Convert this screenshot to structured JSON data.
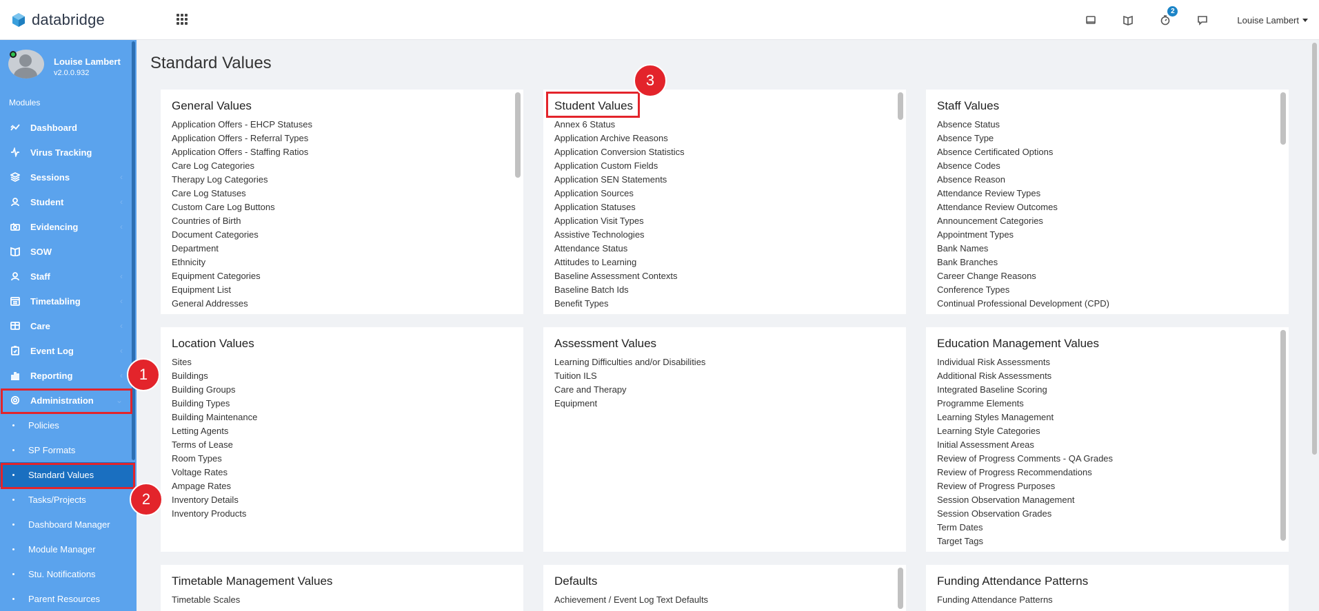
{
  "app": {
    "name": "databridge"
  },
  "topbar": {
    "notification_count": "2",
    "user_name": "Louise Lambert",
    "icons": [
      "tablet-icon",
      "book-icon",
      "timer-icon",
      "chat-icon"
    ]
  },
  "profile": {
    "name": "Louise Lambert",
    "version": "v2.0.0.932"
  },
  "sidebar": {
    "modules_label": "Modules",
    "items": [
      {
        "label": "Dashboard",
        "icon": "trend-icon"
      },
      {
        "label": "Virus Tracking",
        "icon": "pulse-icon"
      },
      {
        "label": "Sessions",
        "icon": "layers-icon"
      },
      {
        "label": "Student",
        "icon": "student-icon"
      },
      {
        "label": "Evidencing",
        "icon": "camera-icon"
      },
      {
        "label": "SOW",
        "icon": "book-icon"
      },
      {
        "label": "Staff",
        "icon": "staff-icon"
      },
      {
        "label": "Timetabling",
        "icon": "calendar-icon"
      },
      {
        "label": "Care",
        "icon": "care-icon"
      },
      {
        "label": "Event Log",
        "icon": "clipboard-icon"
      },
      {
        "label": "Reporting",
        "icon": "bar-chart-icon"
      },
      {
        "label": "Administration",
        "icon": "gear-icon"
      }
    ],
    "subitems": [
      {
        "label": "Policies"
      },
      {
        "label": "SP Formats"
      },
      {
        "label": "Standard Values"
      },
      {
        "label": "Tasks/Projects"
      },
      {
        "label": "Dashboard Manager"
      },
      {
        "label": "Module Manager"
      },
      {
        "label": "Stu. Notifications"
      },
      {
        "label": "Parent Resources"
      }
    ]
  },
  "markers": [
    "1",
    "2",
    "3"
  ],
  "page": {
    "title": "Standard Values"
  },
  "cards": [
    {
      "title": "General Values",
      "items": [
        "Application Offers - EHCP Statuses",
        "Application Offers - Referral Types",
        "Application Offers - Staffing Ratios",
        "Care Log Categories",
        "Therapy Log Categories",
        "Care Log Statuses",
        "Custom Care Log Buttons",
        "Countries of Birth",
        "Document Categories",
        "Department",
        "Ethnicity",
        "Equipment Categories",
        "Equipment List",
        "General Addresses"
      ]
    },
    {
      "title": "Student Values",
      "items": [
        "Annex 6 Status",
        "Application Archive Reasons",
        "Application Conversion Statistics",
        "Application Custom Fields",
        "Application SEN Statements",
        "Application Sources",
        "Application Statuses",
        "Application Visit Types",
        "Assistive Technologies",
        "Attendance Status",
        "Attitudes to Learning",
        "Baseline Assessment Contexts",
        "Baseline Batch Ids",
        "Benefit Types"
      ]
    },
    {
      "title": "Staff Values",
      "items": [
        "Absence Status",
        "Absence Type",
        "Absence Certificated Options",
        "Absence Codes",
        "Absence Reason",
        "Attendance Review Types",
        "Attendance Review Outcomes",
        "Announcement Categories",
        "Appointment Types",
        "Bank Names",
        "Bank Branches",
        "Career Change Reasons",
        "Conference Types",
        "Continual Professional Development (CPD)"
      ]
    },
    {
      "title": "Location Values",
      "items": [
        "Sites",
        "Buildings",
        "Building Groups",
        "Building Types",
        "Building Maintenance",
        "Letting Agents",
        "Terms of Lease",
        "Room Types",
        "Voltage Rates",
        "Ampage Rates",
        "Inventory Details",
        "Inventory Products"
      ]
    },
    {
      "title": "Assessment Values",
      "items": [
        "Learning Difficulties and/or Disabilities",
        "Tuition ILS",
        "Care and Therapy",
        "Equipment"
      ]
    },
    {
      "title": "Education Management Values",
      "items": [
        "Individual Risk Assessments",
        "Additional Risk Assessments",
        "Integrated Baseline Scoring",
        "Programme Elements",
        "Learning Styles Management",
        "Learning Style Categories",
        "Initial Assessment Areas",
        "Review of Progress Comments - QA Grades",
        "Review of Progress Recommendations",
        "Review of Progress Purposes",
        "Session Observation Management",
        "Session Observation Grades",
        "Term Dates",
        "Target Tags"
      ]
    },
    {
      "title": "Timetable Management Values",
      "items": [
        "Timetable Scales"
      ]
    },
    {
      "title": "Defaults",
      "items": [
        "Achievement / Event Log Text Defaults"
      ]
    },
    {
      "title": "Funding Attendance Patterns",
      "items": [
        "Funding Attendance Patterns"
      ]
    }
  ]
}
